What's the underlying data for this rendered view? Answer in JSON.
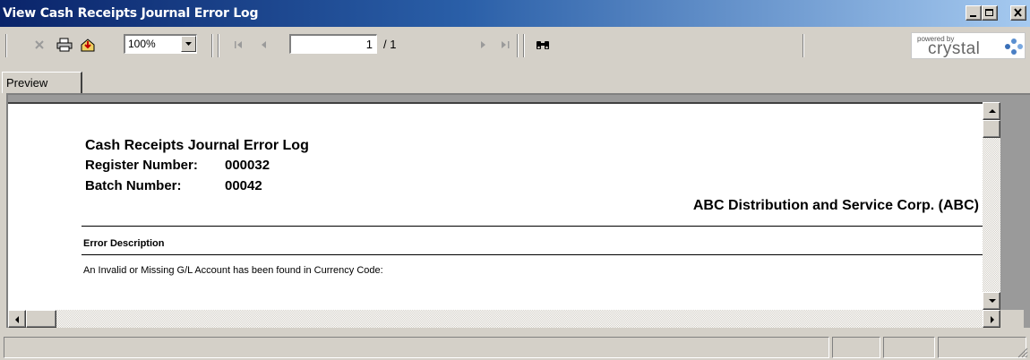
{
  "window": {
    "title": "View Cash Receipts Journal Error Log"
  },
  "toolbar": {
    "zoom_value": "100%",
    "page_current": "1",
    "page_total": "/ 1",
    "logo_powered": "powered by",
    "logo_brand": "crystal"
  },
  "tabs": [
    {
      "label": "Preview"
    }
  ],
  "report": {
    "title": "Cash Receipts Journal Error Log",
    "register_label": "Register Number:",
    "register_value": "000032",
    "batch_label": "Batch Number:",
    "batch_value": "00042",
    "company": "ABC Distribution and Service Corp. (ABC)",
    "column_header": "Error Description",
    "error_text": "An Invalid or Missing G/L Account has been found in Currency Code:"
  },
  "colors": {
    "titlebar_start": "#0a246a",
    "titlebar_end": "#a6caf0",
    "chrome": "#d4d0c8"
  }
}
